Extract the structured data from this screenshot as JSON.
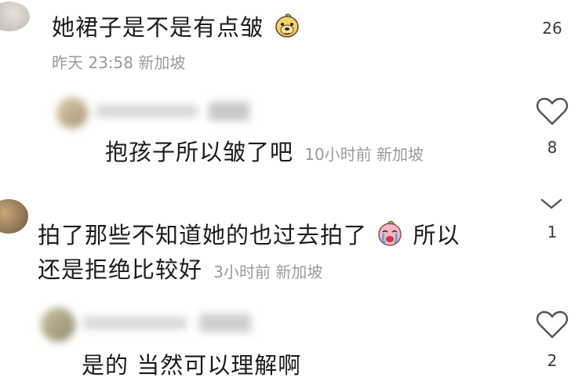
{
  "comments": [
    {
      "text": "她裙子是不是有点皱",
      "emoji": "bear-face",
      "meta": "昨天 23:58 新加坡",
      "like_count": "26"
    },
    {
      "text": "抱孩子所以皱了吧",
      "meta": "10小时前  新加坡",
      "like_count": "8",
      "is_reply": true
    },
    {
      "text_line1": "拍了那些不知道她的也过去拍了",
      "emoji": "crying-face",
      "text_line1_tail": "所以",
      "text_line2": "还是拒绝比较好",
      "meta": "3小时前  新加坡",
      "like_count": "1"
    },
    {
      "text": "是的 当然可以理解啊",
      "like_count": "2",
      "is_reply": true
    }
  ],
  "colors": {
    "text": "#1c1c1c",
    "meta": "#9a9a9a",
    "icon": "#555555"
  }
}
